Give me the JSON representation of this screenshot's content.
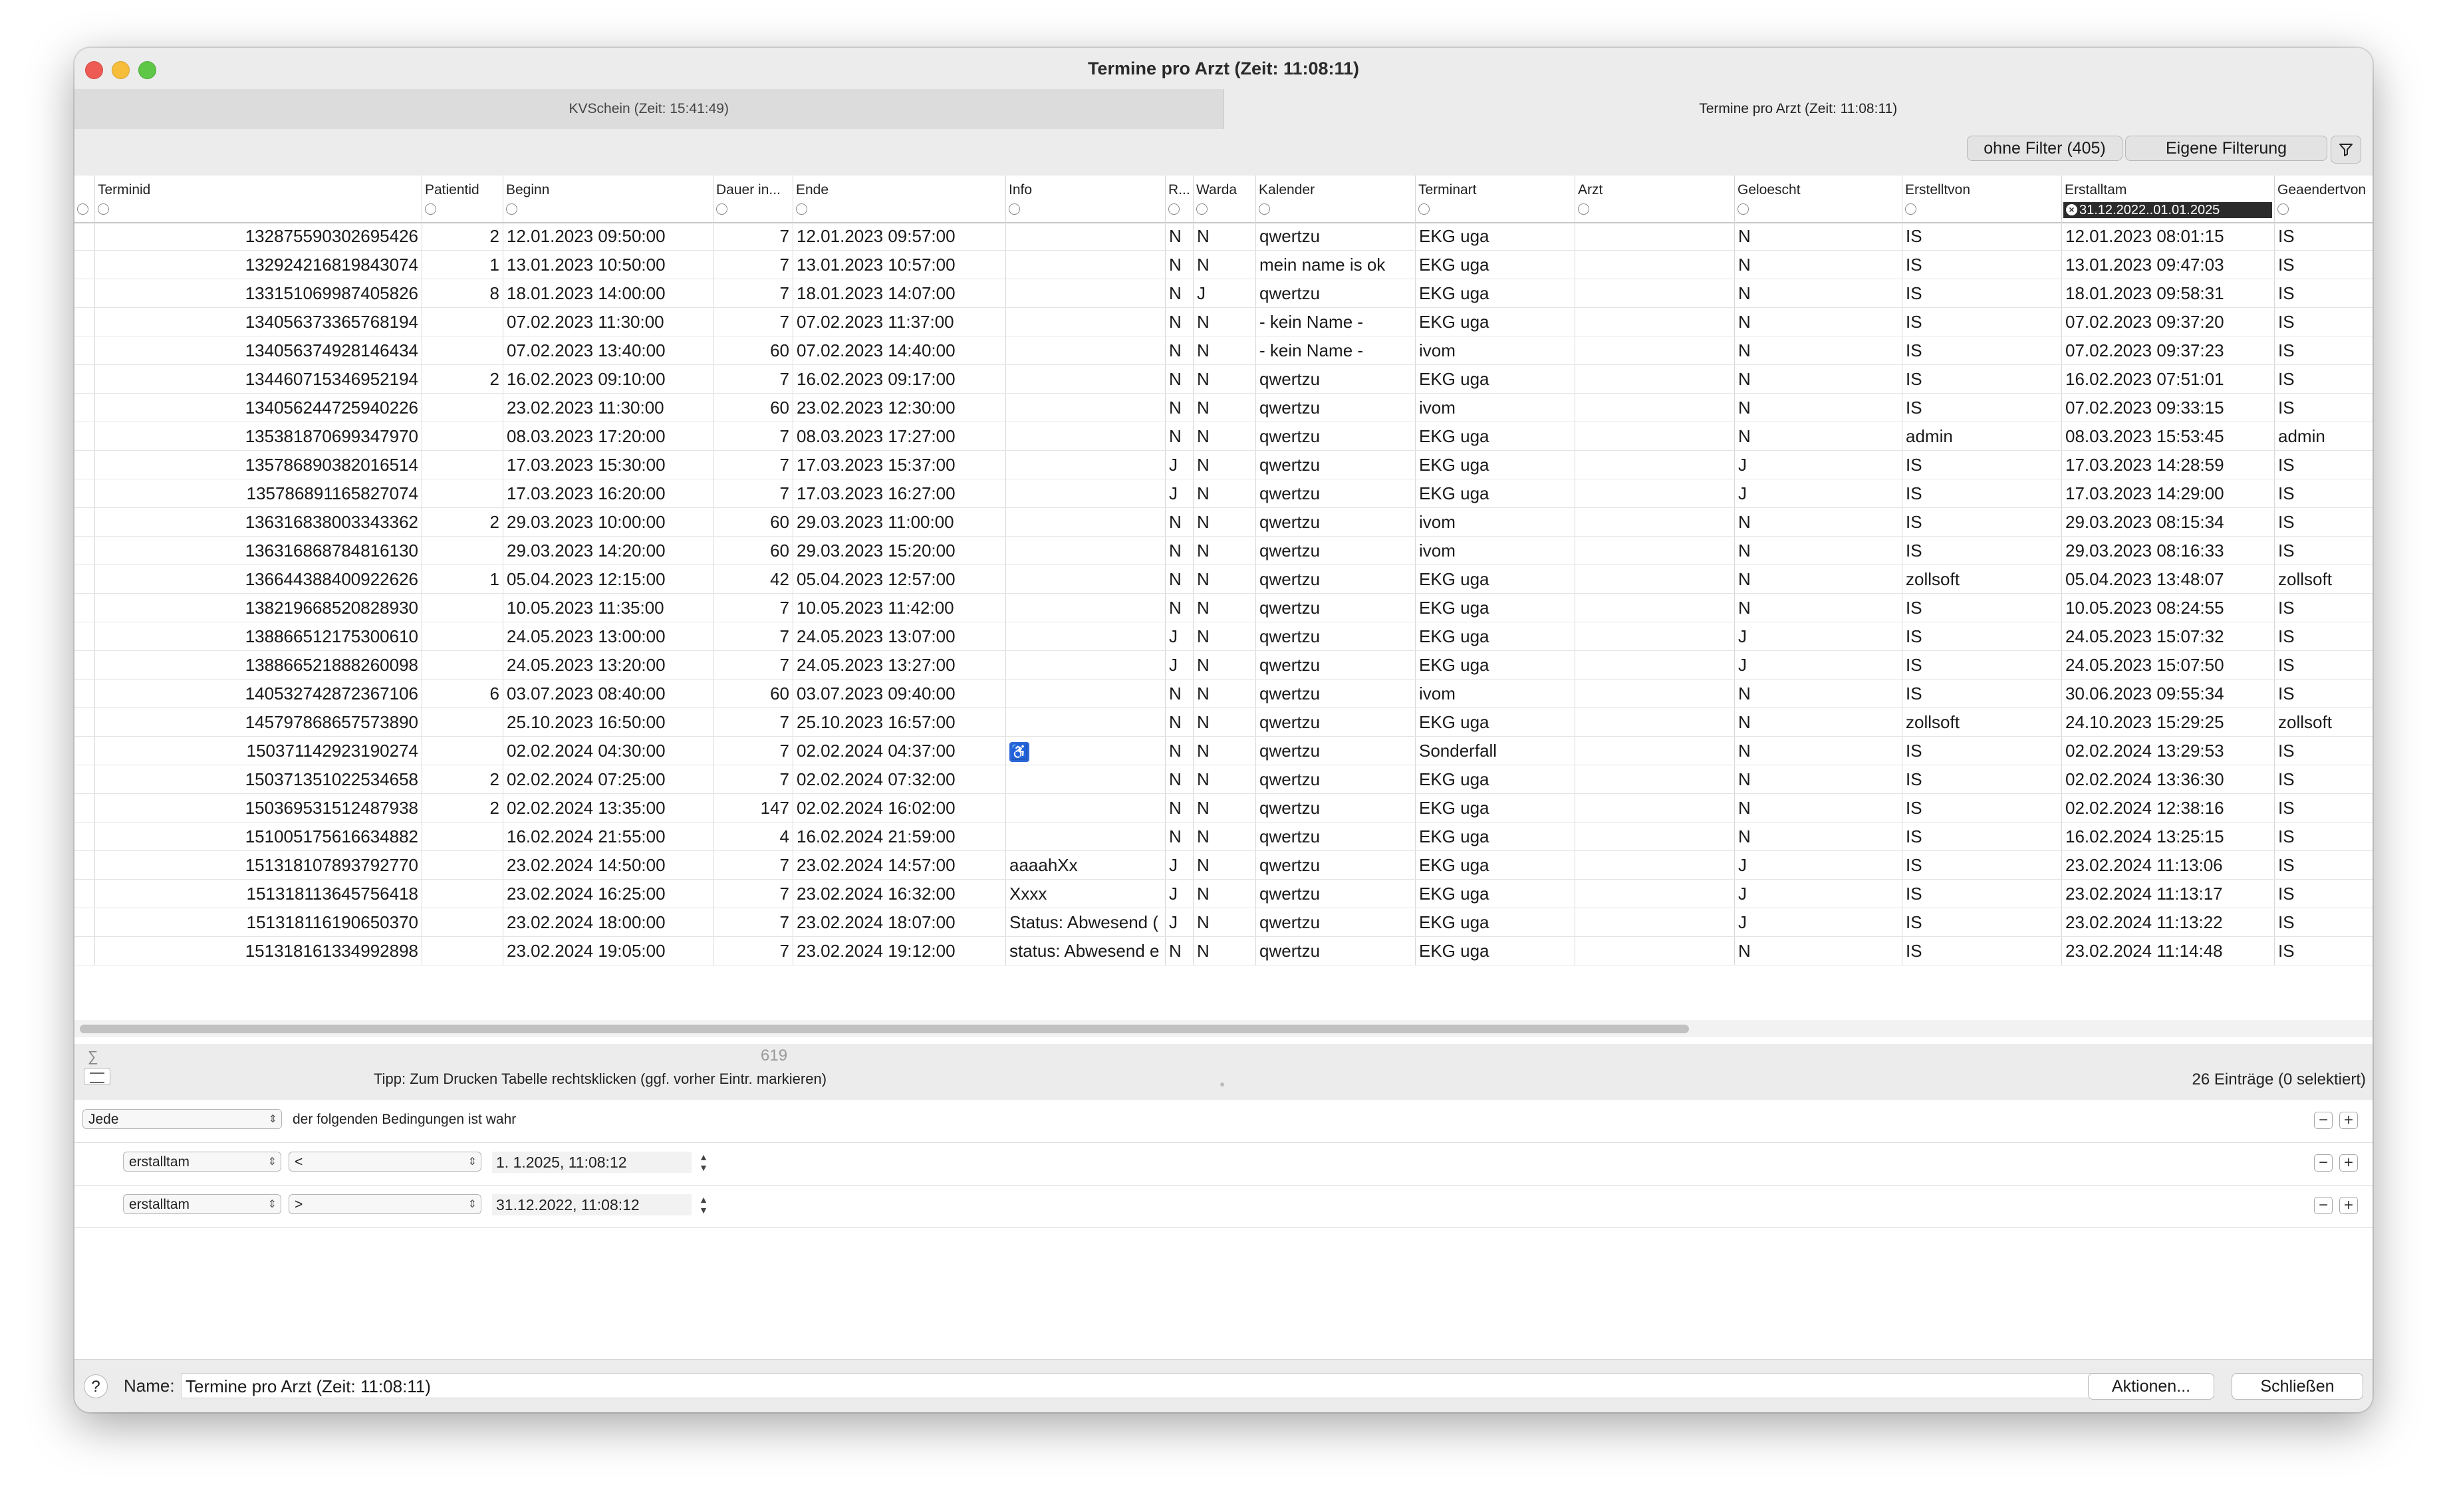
{
  "window": {
    "title": "Termine pro Arzt  (Zeit: 11:08:11)"
  },
  "tabs": [
    {
      "label": "KVSchein  (Zeit: 15:41:49)"
    },
    {
      "label": "Termine pro Arzt  (Zeit: 11:08:11)"
    }
  ],
  "toolbar": {
    "filter_all_label": "ohne Filter (405)",
    "custom_filter_label": "Eigene Filterung",
    "filter_icon": "funnel-icon"
  },
  "table": {
    "columns": [
      {
        "label": "Terminid"
      },
      {
        "label": "Patientid"
      },
      {
        "label": "Beginn"
      },
      {
        "label": "Dauer in..."
      },
      {
        "label": "Ende"
      },
      {
        "label": "Info"
      },
      {
        "label": "R..."
      },
      {
        "label": "Warda"
      },
      {
        "label": "Kalender"
      },
      {
        "label": "Terminart"
      },
      {
        "label": "Arzt"
      },
      {
        "label": "Geloescht"
      },
      {
        "label": "Erstelltvon"
      },
      {
        "label": "Erstalltam",
        "filter": "31.12.2022..01.01.2025"
      },
      {
        "label": "Geaendertvon"
      }
    ],
    "rows": [
      [
        "132875590302695426",
        "2",
        "12.01.2023 09:50:00",
        "7",
        "12.01.2023 09:57:00",
        "",
        "N",
        "N",
        "qwertzu",
        "EKG uga",
        "",
        "N",
        "IS",
        "12.01.2023 08:01:15",
        "IS"
      ],
      [
        "132924216819843074",
        "1",
        "13.01.2023 10:50:00",
        "7",
        "13.01.2023 10:57:00",
        "",
        "N",
        "N",
        "mein name is ok",
        "EKG uga",
        "",
        "N",
        "IS",
        "13.01.2023 09:47:03",
        "IS"
      ],
      [
        "133151069987405826",
        "8",
        "18.01.2023 14:00:00",
        "7",
        "18.01.2023 14:07:00",
        "",
        "N",
        "J",
        "qwertzu",
        "EKG uga",
        "",
        "N",
        "IS",
        "18.01.2023 09:58:31",
        "IS"
      ],
      [
        "134056373365768194",
        "",
        "07.02.2023 11:30:00",
        "7",
        "07.02.2023 11:37:00",
        "",
        "N",
        "N",
        "- kein Name -",
        "EKG uga",
        "",
        "N",
        "IS",
        "07.02.2023 09:37:20",
        "IS"
      ],
      [
        "134056374928146434",
        "",
        "07.02.2023 13:40:00",
        "60",
        "07.02.2023 14:40:00",
        "",
        "N",
        "N",
        "- kein Name -",
        "ivom",
        "",
        "N",
        "IS",
        "07.02.2023 09:37:23",
        "IS"
      ],
      [
        "134460715346952194",
        "2",
        "16.02.2023 09:10:00",
        "7",
        "16.02.2023 09:17:00",
        "",
        "N",
        "N",
        "qwertzu",
        "EKG uga",
        "",
        "N",
        "IS",
        "16.02.2023 07:51:01",
        "IS"
      ],
      [
        "134056244725940226",
        "",
        "23.02.2023 11:30:00",
        "60",
        "23.02.2023 12:30:00",
        "",
        "N",
        "N",
        "qwertzu",
        "ivom",
        "",
        "N",
        "IS",
        "07.02.2023 09:33:15",
        "IS"
      ],
      [
        "135381870699347970",
        "",
        "08.03.2023 17:20:00",
        "7",
        "08.03.2023 17:27:00",
        "",
        "N",
        "N",
        "qwertzu",
        "EKG uga",
        "",
        "N",
        "admin",
        "08.03.2023 15:53:45",
        "admin"
      ],
      [
        "135786890382016514",
        "",
        "17.03.2023 15:30:00",
        "7",
        "17.03.2023 15:37:00",
        "",
        "J",
        "N",
        "qwertzu",
        "EKG uga",
        "",
        "J",
        "IS",
        "17.03.2023 14:28:59",
        "IS"
      ],
      [
        "135786891165827074",
        "",
        "17.03.2023 16:20:00",
        "7",
        "17.03.2023 16:27:00",
        "",
        "J",
        "N",
        "qwertzu",
        "EKG uga",
        "",
        "J",
        "IS",
        "17.03.2023 14:29:00",
        "IS"
      ],
      [
        "136316838003343362",
        "2",
        "29.03.2023 10:00:00",
        "60",
        "29.03.2023 11:00:00",
        "",
        "N",
        "N",
        "qwertzu",
        "ivom",
        "",
        "N",
        "IS",
        "29.03.2023 08:15:34",
        "IS"
      ],
      [
        "136316868784816130",
        "",
        "29.03.2023 14:20:00",
        "60",
        "29.03.2023 15:20:00",
        "",
        "N",
        "N",
        "qwertzu",
        "ivom",
        "",
        "N",
        "IS",
        "29.03.2023 08:16:33",
        "IS"
      ],
      [
        "136644388400922626",
        "1",
        "05.04.2023 12:15:00",
        "42",
        "05.04.2023 12:57:00",
        "",
        "N",
        "N",
        "qwertzu",
        "EKG uga",
        "",
        "N",
        "zollsoft",
        "05.04.2023 13:48:07",
        "zollsoft"
      ],
      [
        "138219668520828930",
        "",
        "10.05.2023 11:35:00",
        "7",
        "10.05.2023 11:42:00",
        "",
        "N",
        "N",
        "qwertzu",
        "EKG uga",
        "",
        "N",
        "IS",
        "10.05.2023 08:24:55",
        "IS"
      ],
      [
        "138866512175300610",
        "",
        "24.05.2023 13:00:00",
        "7",
        "24.05.2023 13:07:00",
        "",
        "J",
        "N",
        "qwertzu",
        "EKG uga",
        "",
        "J",
        "IS",
        "24.05.2023 15:07:32",
        "IS"
      ],
      [
        "138866521888260098",
        "",
        "24.05.2023 13:20:00",
        "7",
        "24.05.2023 13:27:00",
        "",
        "J",
        "N",
        "qwertzu",
        "EKG uga",
        "",
        "J",
        "IS",
        "24.05.2023 15:07:50",
        "IS"
      ],
      [
        "140532742872367106",
        "6",
        "03.07.2023 08:40:00",
        "60",
        "03.07.2023 09:40:00",
        "",
        "N",
        "N",
        "qwertzu",
        "ivom",
        "",
        "N",
        "IS",
        "30.06.2023 09:55:34",
        "IS"
      ],
      [
        "145797868657573890",
        "",
        "25.10.2023 16:50:00",
        "7",
        "25.10.2023 16:57:00",
        "",
        "N",
        "N",
        "qwertzu",
        "EKG uga",
        "",
        "N",
        "zollsoft",
        "24.10.2023 15:29:25",
        "zollsoft"
      ],
      [
        "150371142923190274",
        "",
        "02.02.2024 04:30:00",
        "7",
        "02.02.2024 04:37:00",
        "wheelchair-icon",
        "N",
        "N",
        "qwertzu",
        "Sonderfall",
        "",
        "N",
        "IS",
        "02.02.2024 13:29:53",
        "IS"
      ],
      [
        "150371351022534658",
        "2",
        "02.02.2024 07:25:00",
        "7",
        "02.02.2024 07:32:00",
        "",
        "N",
        "N",
        "qwertzu",
        "EKG uga",
        "",
        "N",
        "IS",
        "02.02.2024 13:36:30",
        "IS"
      ],
      [
        "150369531512487938",
        "2",
        "02.02.2024 13:35:00",
        "147",
        "02.02.2024 16:02:00",
        "",
        "N",
        "N",
        "qwertzu",
        "EKG uga",
        "",
        "N",
        "IS",
        "02.02.2024 12:38:16",
        "IS"
      ],
      [
        "151005175616634882",
        "",
        "16.02.2024 21:55:00",
        "4",
        "16.02.2024 21:59:00",
        "",
        "N",
        "N",
        "qwertzu",
        "EKG uga",
        "",
        "N",
        "IS",
        "16.02.2024 13:25:15",
        "IS"
      ],
      [
        "151318107893792770",
        "",
        "23.02.2024 14:50:00",
        "7",
        "23.02.2024 14:57:00",
        "aaaahXx",
        "J",
        "N",
        "qwertzu",
        "EKG uga",
        "",
        "J",
        "IS",
        "23.02.2024 11:13:06",
        "IS"
      ],
      [
        "151318113645756418",
        "",
        "23.02.2024 16:25:00",
        "7",
        "23.02.2024 16:32:00",
        "Xxxx",
        "J",
        "N",
        "qwertzu",
        "EKG uga",
        "",
        "J",
        "IS",
        "23.02.2024 11:13:17",
        "IS"
      ],
      [
        "151318116190650370",
        "",
        "23.02.2024 18:00:00",
        "7",
        "23.02.2024 18:07:00",
        "Status: Abwesend (",
        "J",
        "N",
        "qwertzu",
        "EKG uga",
        "",
        "J",
        "IS",
        "23.02.2024 11:13:22",
        "IS"
      ],
      [
        "151318161334992898",
        "",
        "23.02.2024 19:05:00",
        "7",
        "23.02.2024 19:12:00",
        "status: Abwesend e",
        "N",
        "N",
        "qwertzu",
        "EKG uga",
        "",
        "N",
        "IS",
        "23.02.2024 11:14:48",
        "IS"
      ]
    ]
  },
  "status": {
    "sum_symbol": "∑",
    "sum_value": "619",
    "tip": "Tipp: Zum Drucken Tabelle rechtsklicken (ggf. vorher Eintr. markieren)",
    "count": "26 Einträge (0 selektiert)"
  },
  "predicate": {
    "match_value": "Jede",
    "match_suffix": "der folgenden Bedingungen ist wahr",
    "rows": [
      {
        "field": "erstalltam",
        "operator": "<",
        "value": "1.  1.2025, 11:08:12"
      },
      {
        "field": "erstalltam",
        "operator": ">",
        "value": "31.12.2022, 11:08:12"
      }
    ]
  },
  "bottom": {
    "help_label": "?",
    "name_label": "Name:",
    "name_value": "Termine pro Arzt  (Zeit: 11:08:11)",
    "actions_label": "Aktionen...",
    "close_label": "Schließen"
  }
}
